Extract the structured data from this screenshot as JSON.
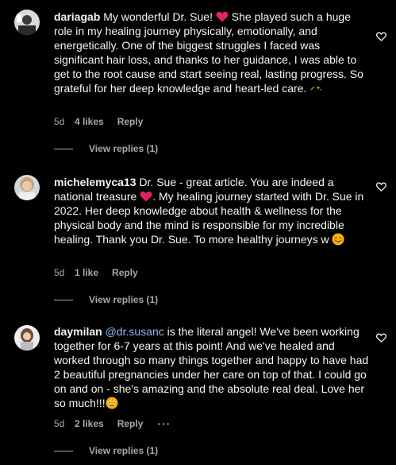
{
  "comments": [
    {
      "username": "dariagab",
      "text_before_heart": " My wonderful Dr. Sue! ",
      "text_after_heart": " She played such a huge role in my healing journey physically, emotionally, and energetically. One of the biggest struggles I faced was significant hair loss, and thanks to her guidance, I was able to get to the root cause and start seeing real, lasting progress. So grateful for her deep knowledge and heart-led care. ",
      "age": "5d",
      "likes": "4 likes",
      "reply_label": "Reply",
      "view_replies": "View replies (1)"
    },
    {
      "username": "michelemyca13",
      "text_before_heart": " Dr. Sue - great article. You are indeed a national treasure ",
      "text_after_heart": ". My healing journey started with Dr. Sue in 2022. Her deep knowledge about health & wellness for the physical body and the mind is responsible for my incredible healing. Thank you Dr. Sue. To more healthy journeys w ",
      "age": "5d",
      "likes": "1 like",
      "reply_label": "Reply",
      "view_replies": "View replies (1)"
    },
    {
      "username": "daymilan",
      "mention": "@dr.susanc",
      "text": " is the literal angel! We've been working together for 6-7 years at this point! And we've healed and worked through so many things together and happy to have had 2 beautiful pregnancies under her care on top of that. I could go on and on - she's amazing and the absolute real deal. Love her so much!!!",
      "age": "5d",
      "likes": "2 likes",
      "reply_label": "Reply",
      "more_label": "···",
      "view_replies": "View replies (1)"
    }
  ],
  "colors": {
    "background": "#000000",
    "text": "#f5f5f5",
    "secondary": "#a8a8a8",
    "mention": "#8fb8f0",
    "heart_red": "#e0245e"
  },
  "icons": {
    "heart_emoji": "red-heart",
    "leaf_sparkle_emoji": "herb-sparkles",
    "smile_emoji": "smiling-face",
    "tear_emoji": "face-holding-back-tears",
    "like_button": "heart-outline"
  }
}
